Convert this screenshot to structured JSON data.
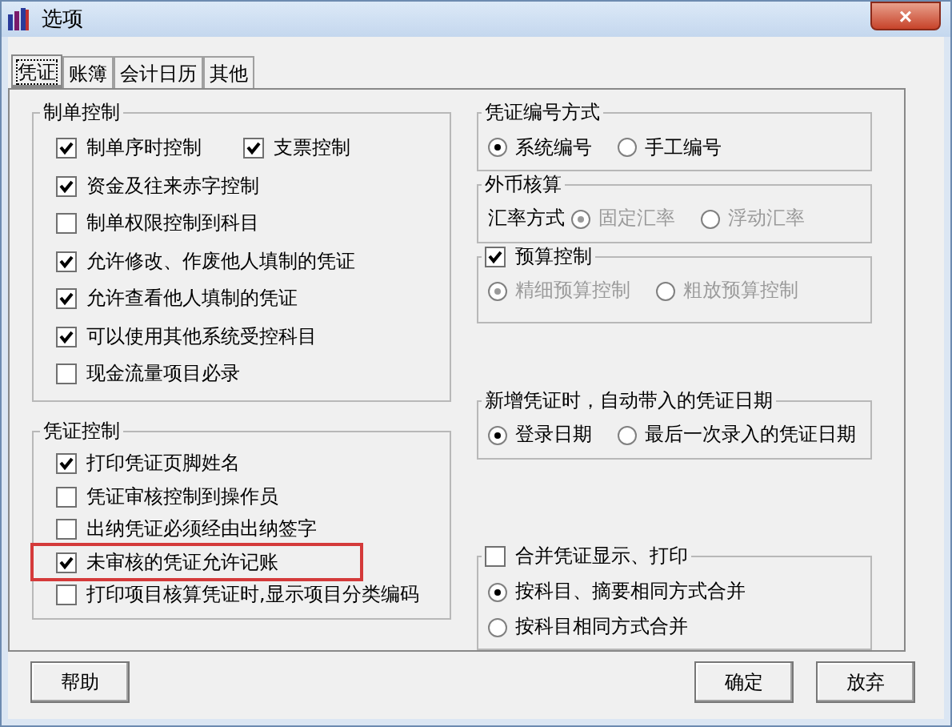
{
  "window": {
    "title": "选项",
    "close": "×"
  },
  "tabs": [
    {
      "label": "凭证",
      "selected": true
    },
    {
      "label": "账簿",
      "selected": false
    },
    {
      "label": "会计日历",
      "selected": false
    },
    {
      "label": "其他",
      "selected": false
    }
  ],
  "left_groups": [
    {
      "title": "制单控制",
      "rows": [
        [
          {
            "kind": "check",
            "label": "制单序时控制",
            "checked": true,
            "highlighted": false
          },
          {
            "kind": "check",
            "label": "支票控制",
            "checked": true,
            "highlighted": false
          }
        ],
        [
          {
            "kind": "check",
            "label": "资金及往来赤字控制",
            "checked": true,
            "highlighted": false
          }
        ],
        [
          {
            "kind": "check",
            "label": "制单权限控制到科目",
            "checked": false,
            "highlighted": false
          }
        ],
        [
          {
            "kind": "check",
            "label": "允许修改、作废他人填制的凭证",
            "checked": true,
            "highlighted": false
          }
        ],
        [
          {
            "kind": "check",
            "label": "允许查看他人填制的凭证",
            "checked": true,
            "highlighted": false
          }
        ],
        [
          {
            "kind": "check",
            "label": "可以使用其他系统受控科目",
            "checked": true,
            "highlighted": false
          }
        ],
        [
          {
            "kind": "check",
            "label": "现金流量项目必录",
            "checked": false,
            "highlighted": false
          }
        ]
      ]
    },
    {
      "title": "凭证控制",
      "rows": [
        [
          {
            "kind": "check",
            "label": "打印凭证页脚姓名",
            "checked": true,
            "highlighted": false
          }
        ],
        [
          {
            "kind": "check",
            "label": "凭证审核控制到操作员",
            "checked": false,
            "highlighted": false
          }
        ],
        [
          {
            "kind": "check",
            "label": "出纳凭证必须经由出纳签字",
            "checked": false,
            "highlighted": false
          }
        ],
        [
          {
            "kind": "check",
            "label": "未审核的凭证允许记账",
            "checked": true,
            "highlighted": true
          }
        ],
        [
          {
            "kind": "check",
            "label": "打印项目核算凭证时,显示项目分类编码",
            "checked": false,
            "highlighted": false
          }
        ]
      ]
    }
  ],
  "right_groups": [
    {
      "title": "凭证编号方式",
      "rows": [
        [
          {
            "kind": "radio",
            "label": "系统编号",
            "selected": true,
            "disabled": false
          },
          {
            "kind": "radio",
            "label": "手工编号",
            "selected": false,
            "disabled": false
          }
        ]
      ]
    },
    {
      "title": "外币核算",
      "rows": [
        [
          {
            "kind": "text",
            "label": "汇率方式"
          },
          {
            "kind": "radio",
            "label": "固定汇率",
            "selected": true,
            "disabled": true
          },
          {
            "kind": "radio",
            "label": "浮动汇率",
            "selected": false,
            "disabled": true
          }
        ]
      ]
    },
    {
      "title": "预算控制",
      "title_checked": true,
      "rows": [
        [
          {
            "kind": "radio",
            "label": "精细预算控制",
            "selected": true,
            "disabled": true
          },
          {
            "kind": "radio",
            "label": "粗放预算控制",
            "selected": false,
            "disabled": true
          }
        ]
      ]
    },
    {
      "title": "新增凭证时，自动带入的凭证日期",
      "rows": [
        [
          {
            "kind": "radio",
            "label": "登录日期",
            "selected": true,
            "disabled": false
          },
          {
            "kind": "radio",
            "label": "最后一次录入的凭证日期",
            "selected": false,
            "disabled": false
          }
        ]
      ]
    },
    {
      "title": "合并凭证显示、打印",
      "title_checked": false,
      "rows": [
        [
          {
            "kind": "radio",
            "label": "按科目、摘要相同方式合并",
            "selected": true,
            "disabled": false
          }
        ],
        [
          {
            "kind": "radio",
            "label": "按科目相同方式合并",
            "selected": false,
            "disabled": false
          }
        ]
      ]
    }
  ],
  "buttons": {
    "help": "帮助",
    "ok": "确定",
    "cancel": "放弃"
  }
}
